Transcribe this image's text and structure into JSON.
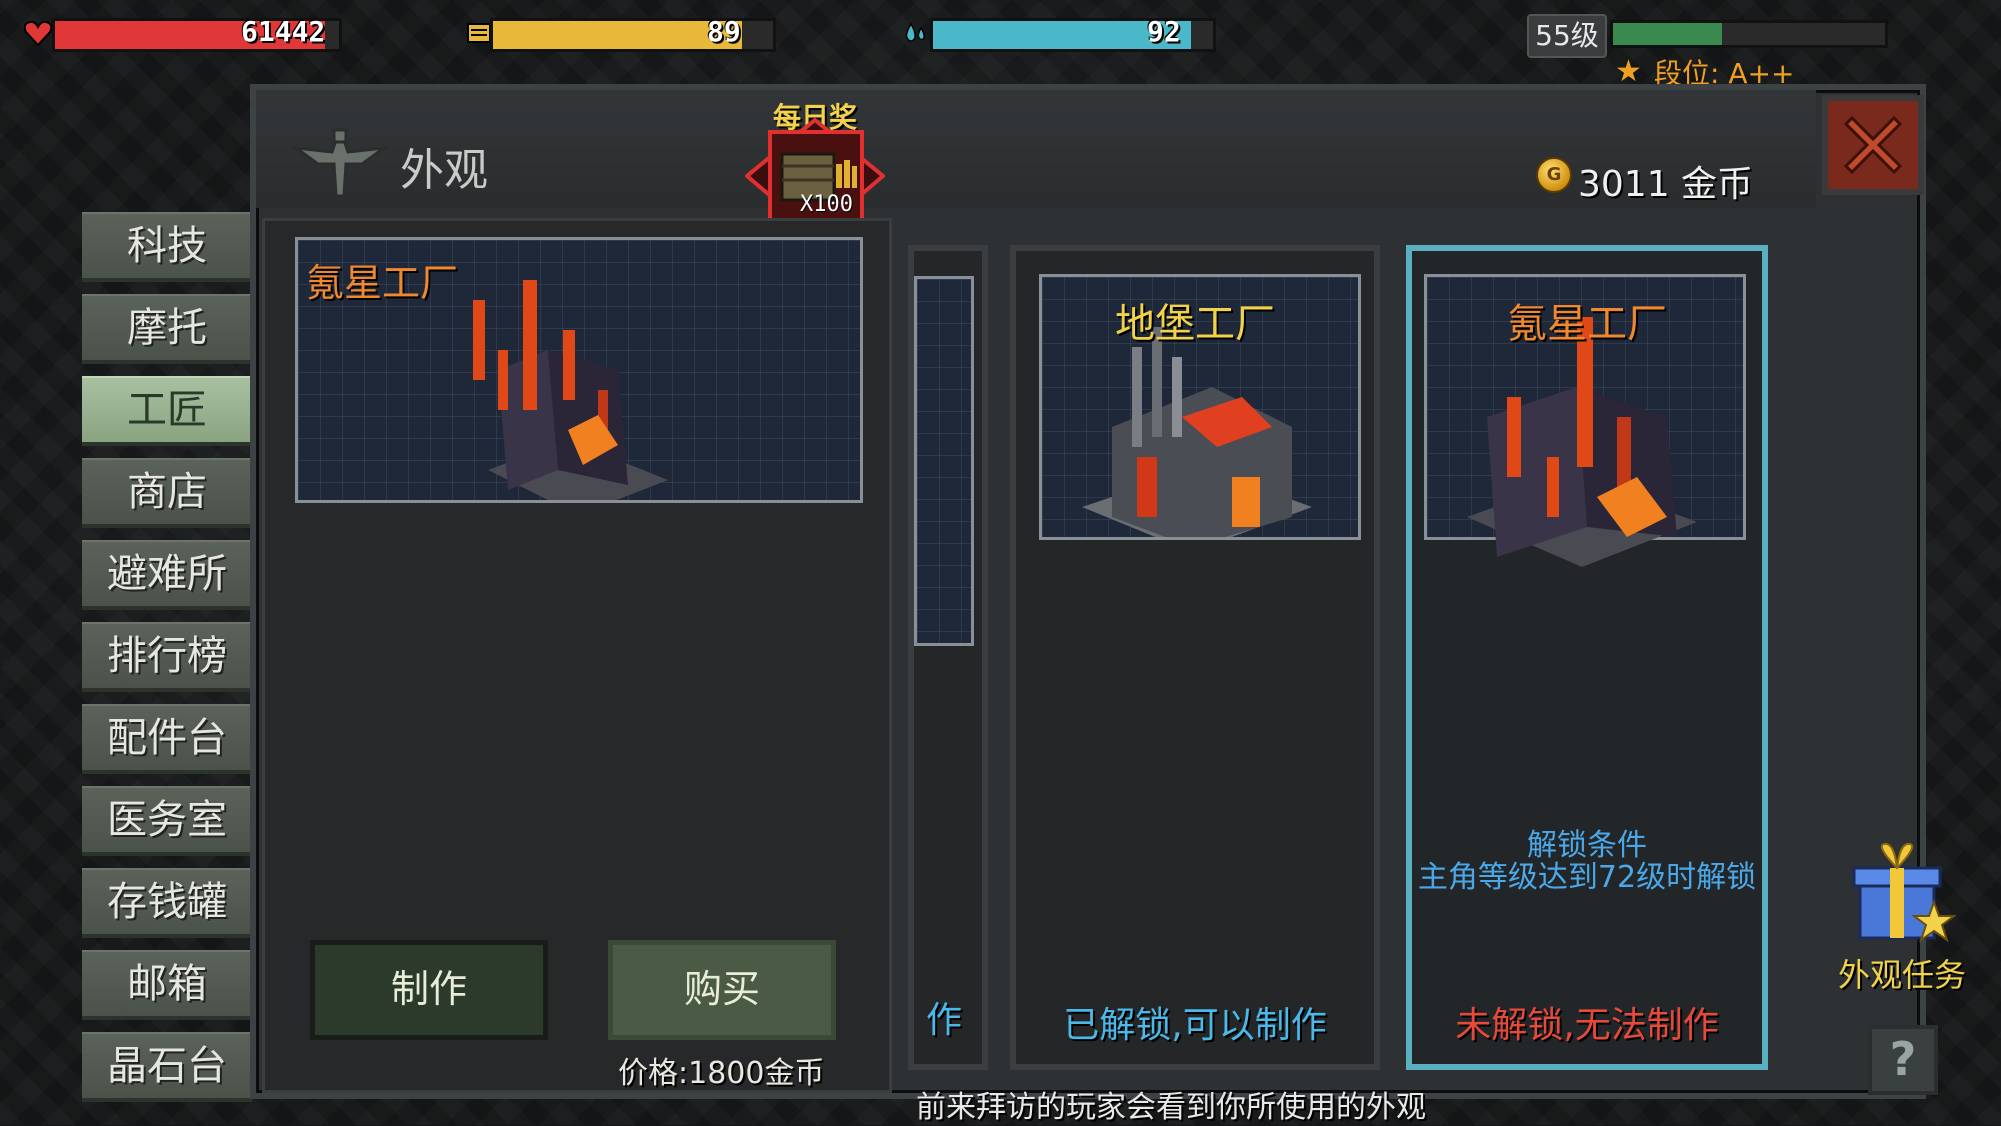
{
  "hud": {
    "health": {
      "value": "61442",
      "fill_fraction": 0.95,
      "color": "#e03838"
    },
    "food": {
      "value": "89",
      "fill_fraction": 0.89,
      "color": "#e8b83a"
    },
    "water": {
      "value": "92",
      "fill_fraction": 0.92,
      "color": "#4ab8c8"
    },
    "level": "55级",
    "xp_fraction": 0.4,
    "rank": "段位: A++"
  },
  "panel": {
    "title": "外观",
    "daily_reward_label": "每日奖",
    "daily_reward_count": "X100",
    "coins": "3011 金币"
  },
  "sidebar": {
    "items": [
      {
        "label": "科技"
      },
      {
        "label": "摩托"
      },
      {
        "label": "工匠",
        "active": true
      },
      {
        "label": "商店"
      },
      {
        "label": "避难所"
      },
      {
        "label": "排行榜"
      },
      {
        "label": "配件台"
      },
      {
        "label": "医务室"
      },
      {
        "label": "存钱罐"
      },
      {
        "label": "邮箱"
      },
      {
        "label": "晶石台"
      }
    ]
  },
  "preview": {
    "name": "氪星工厂",
    "make_label": "制作",
    "buy_label": "购买",
    "price": "价格:1800金币"
  },
  "cards": [
    {
      "title": "",
      "status": "作"
    },
    {
      "title": "地堡工厂",
      "status": "已解锁,可以制作",
      "title_color": "#f2d24a",
      "status_color": "#4ab8e8"
    },
    {
      "title": "氪星工厂",
      "status": "未解锁,无法制作",
      "title_color": "#f08830",
      "status_color": "#e84a3a",
      "unlock_title": "解锁条件",
      "unlock_desc": "主角等级达到72级时解锁"
    }
  ],
  "footer": "前来拜访的玩家会看到你所使用的外观",
  "gift": {
    "label": "外观任务"
  },
  "help": {
    "label": "?"
  }
}
